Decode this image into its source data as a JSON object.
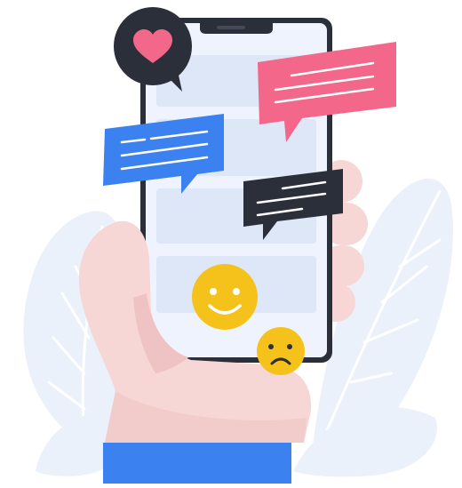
{
  "illustration": {
    "subject": "",
    "icons": {
      "heart_bubble": "heart-icon",
      "smile": "smile-emoji-icon",
      "sad": "sad-emoji-icon"
    },
    "colors": {
      "background_leaves": "#eaf1fb",
      "leaf_veins": "#ffffff",
      "phone_frame": "#2b2f3a",
      "phone_screen": "#eef3fd",
      "screen_cards": "#dde7f8",
      "hand_skin": "#f7d6d6",
      "hand_shadow": "#efc3c3",
      "sleeve": "#3b82f0",
      "bubble_pink": "#f2678a",
      "bubble_blue": "#3b82f0",
      "bubble_dark": "#2b2f3a",
      "heart_bubble_bg": "#2b2f3a",
      "heart": "#f2678a",
      "emoji_yellow": "#f5c21b",
      "emoji_features": "#ffffff",
      "text_lines": "#ffffff"
    }
  }
}
